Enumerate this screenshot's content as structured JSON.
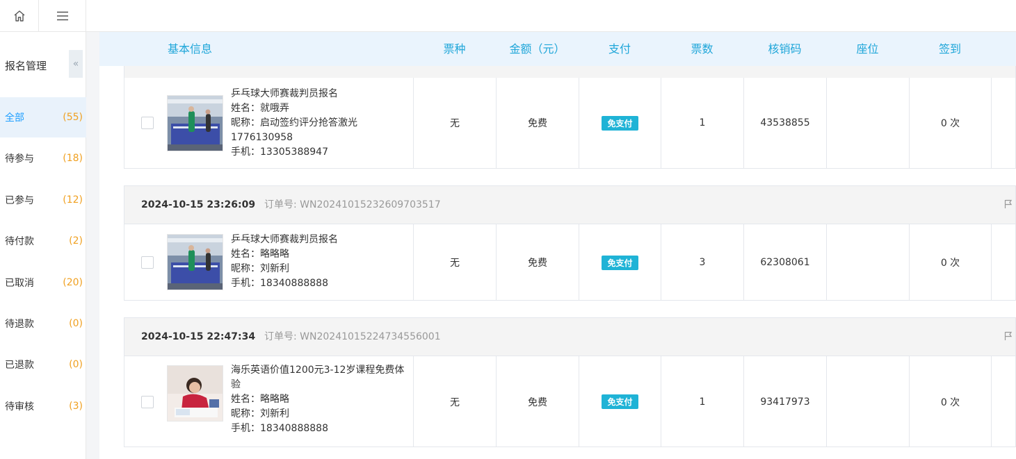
{
  "sidebar": {
    "title": "报名管理",
    "collapse_glyph": "«",
    "items": [
      {
        "label": "全部",
        "count": "(55)"
      },
      {
        "label": "待参与",
        "count": "(18)"
      },
      {
        "label": "已参与",
        "count": "(12)"
      },
      {
        "label": "待付款",
        "count": "(2)"
      },
      {
        "label": "已取消",
        "count": "(20)"
      },
      {
        "label": "待退款",
        "count": "(0)"
      },
      {
        "label": "已退款",
        "count": "(0)"
      },
      {
        "label": "待审核",
        "count": "(3)"
      }
    ]
  },
  "table": {
    "headers": [
      "基本信息",
      "票种",
      "金额（元）",
      "支付",
      "票数",
      "核销码",
      "座位",
      "签到"
    ]
  },
  "orders": [
    {
      "time": "",
      "order_no": "",
      "event": "乒乓球大师赛裁判员报名",
      "name": "姓名：就哦弄",
      "nickname": "昵称：启动签约评分抢答激光",
      "extra": "1776130958",
      "phone": "手机：13305388947",
      "ticket_type": "无",
      "amount": "免费",
      "pay": "免支付",
      "qty": "1",
      "code": "43538855",
      "seat": "",
      "checkin": "0 次"
    },
    {
      "time": "2024-10-15 23:26:09",
      "order_no": "订单号: WN20241015232609703517",
      "event": "乒乓球大师赛裁判员报名",
      "name": "姓名：略略略",
      "nickname": "昵称：刘新利",
      "phone": "手机：18340888888",
      "ticket_type": "无",
      "amount": "免费",
      "pay": "免支付",
      "qty": "3",
      "code": "62308061",
      "seat": "",
      "checkin": "0 次"
    },
    {
      "time": "2024-10-15 22:47:34",
      "order_no": "订单号: WN20241015224734556001",
      "event": "海乐英语价值1200元3-12岁课程免费体验",
      "name": "姓名：略略略",
      "nickname": "昵称：刘新利",
      "phone": "手机：18340888888",
      "ticket_type": "无",
      "amount": "免费",
      "pay": "免支付",
      "qty": "1",
      "code": "93417973",
      "seat": "",
      "checkin": "0 次"
    }
  ],
  "icons": {
    "home": "home-icon",
    "menu": "hamburger-menu-icon",
    "flag": "flag-icon"
  },
  "colors": {
    "accent": "#1fa6d9",
    "badge": "#1fb3d6",
    "count": "#f0a020",
    "active_bg": "#e9f2fb"
  }
}
